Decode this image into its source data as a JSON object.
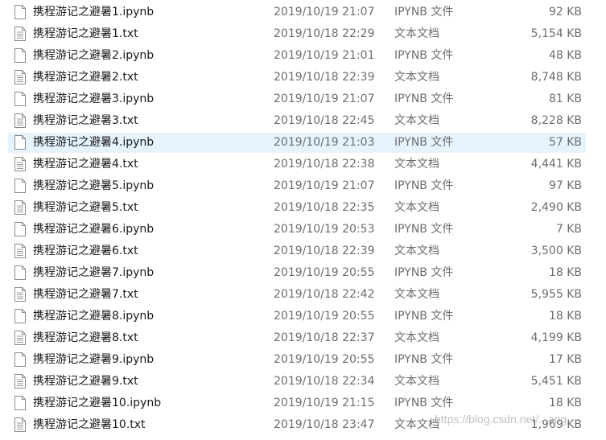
{
  "files": [
    {
      "name": "携程游记之避暑1.ipynb",
      "modified": "2019/10/19 21:07",
      "type": "IPYNB 文件",
      "size": "92 KB",
      "icon": "ipynb-file-icon",
      "selected": false
    },
    {
      "name": "携程游记之避暑1.txt",
      "modified": "2019/10/18 22:29",
      "type": "文本文档",
      "size": "5,154 KB",
      "icon": "text-file-icon",
      "selected": false
    },
    {
      "name": "携程游记之避暑2.ipynb",
      "modified": "2019/10/19 21:01",
      "type": "IPYNB 文件",
      "size": "48 KB",
      "icon": "ipynb-file-icon",
      "selected": false
    },
    {
      "name": "携程游记之避暑2.txt",
      "modified": "2019/10/18 22:39",
      "type": "文本文档",
      "size": "8,748 KB",
      "icon": "text-file-icon",
      "selected": false
    },
    {
      "name": "携程游记之避暑3.ipynb",
      "modified": "2019/10/19 21:07",
      "type": "IPYNB 文件",
      "size": "81 KB",
      "icon": "ipynb-file-icon",
      "selected": false
    },
    {
      "name": "携程游记之避暑3.txt",
      "modified": "2019/10/18 22:45",
      "type": "文本文档",
      "size": "8,228 KB",
      "icon": "text-file-icon",
      "selected": false
    },
    {
      "name": "携程游记之避暑4.ipynb",
      "modified": "2019/10/19 21:03",
      "type": "IPYNB 文件",
      "size": "57 KB",
      "icon": "ipynb-file-icon",
      "selected": true
    },
    {
      "name": "携程游记之避暑4.txt",
      "modified": "2019/10/18 22:38",
      "type": "文本文档",
      "size": "4,441 KB",
      "icon": "text-file-icon",
      "selected": false
    },
    {
      "name": "携程游记之避暑5.ipynb",
      "modified": "2019/10/19 21:07",
      "type": "IPYNB 文件",
      "size": "97 KB",
      "icon": "ipynb-file-icon",
      "selected": false
    },
    {
      "name": "携程游记之避暑5.txt",
      "modified": "2019/10/18 22:35",
      "type": "文本文档",
      "size": "2,490 KB",
      "icon": "text-file-icon",
      "selected": false
    },
    {
      "name": "携程游记之避暑6.ipynb",
      "modified": "2019/10/19 20:53",
      "type": "IPYNB 文件",
      "size": "7 KB",
      "icon": "ipynb-file-icon",
      "selected": false
    },
    {
      "name": "携程游记之避暑6.txt",
      "modified": "2019/10/18 22:39",
      "type": "文本文档",
      "size": "3,500 KB",
      "icon": "text-file-icon",
      "selected": false
    },
    {
      "name": "携程游记之避暑7.ipynb",
      "modified": "2019/10/19 20:55",
      "type": "IPYNB 文件",
      "size": "18 KB",
      "icon": "ipynb-file-icon",
      "selected": false
    },
    {
      "name": "携程游记之避暑7.txt",
      "modified": "2019/10/18 22:42",
      "type": "文本文档",
      "size": "5,955 KB",
      "icon": "text-file-icon",
      "selected": false
    },
    {
      "name": "携程游记之避暑8.ipynb",
      "modified": "2019/10/19 20:55",
      "type": "IPYNB 文件",
      "size": "18 KB",
      "icon": "ipynb-file-icon",
      "selected": false
    },
    {
      "name": "携程游记之避暑8.txt",
      "modified": "2019/10/18 22:37",
      "type": "文本文档",
      "size": "4,199 KB",
      "icon": "text-file-icon",
      "selected": false
    },
    {
      "name": "携程游记之避暑9.ipynb",
      "modified": "2019/10/19 20:55",
      "type": "IPYNB 文件",
      "size": "17 KB",
      "icon": "ipynb-file-icon",
      "selected": false
    },
    {
      "name": "携程游记之避暑9.txt",
      "modified": "2019/10/18 22:34",
      "type": "文本文档",
      "size": "5,451 KB",
      "icon": "text-file-icon",
      "selected": false
    },
    {
      "name": "携程游记之避暑10.ipynb",
      "modified": "2019/10/19 21:15",
      "type": "IPYNB 文件",
      "size": "18 KB",
      "icon": "ipynb-file-icon",
      "selected": false
    },
    {
      "name": "携程游记之避暑10.txt",
      "modified": "2019/10/18 23:47",
      "type": "文本文档",
      "size": "1,969 KB",
      "icon": "text-file-icon",
      "selected": false
    }
  ],
  "watermark": "https://blog.csdn.net/...ang",
  "colors": {
    "selection": "#e5f3ff",
    "name_text": "#1a1a1a",
    "detail_text": "#6d6d6d"
  }
}
